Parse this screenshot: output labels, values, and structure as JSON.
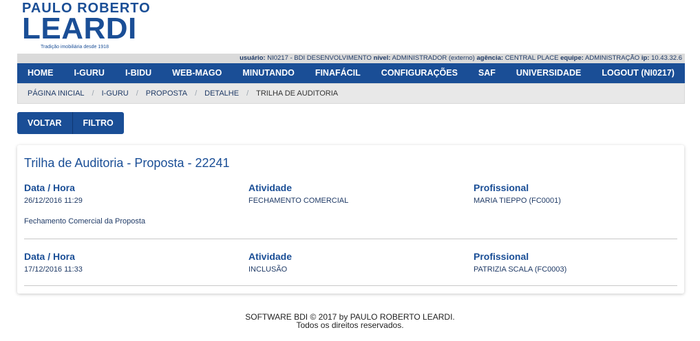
{
  "logo": {
    "line1": "PAULO ROBERTO",
    "line2": "LEARDI",
    "tagline": "Tradição imobiliária desde 1918"
  },
  "infobar": {
    "usuario_label": "usuário:",
    "usuario_value": "NI0217 - BDI DESENVOLVIMENTO",
    "nivel_label": "nível:",
    "nivel_value": "ADMINISTRADOR (externo)",
    "agencia_label": "agência:",
    "agencia_value": "CENTRAL PLACE",
    "equipe_label": "equipe:",
    "equipe_value": "ADMINISTRAÇÃO",
    "ip_label": "ip:",
    "ip_value": "10.43.32.6"
  },
  "nav": {
    "items": [
      "HOME",
      "I-GURU",
      "I-BIDU",
      "WEB-MAGO",
      "MINUTANDO",
      "FINAFÁCIL",
      "CONFIGURAÇÕES",
      "SAF",
      "UNIVERSIDADE",
      "LOGOUT (NI0217)"
    ]
  },
  "breadcrumb": {
    "items": [
      "PÁGINA INICIAL",
      "I-GURU",
      "PROPOSTA",
      "DETALHE",
      "TRILHA DE AUDITORIA"
    ],
    "separator": "/"
  },
  "toolbar": {
    "voltar_label": "VOLTAR",
    "filtro_label": "FILTRO"
  },
  "card": {
    "title": "Trilha de Auditoria - Proposta - 22241",
    "labels": {
      "datetime": "Data / Hora",
      "activity": "Atividade",
      "professional": "Profissional"
    },
    "entries": [
      {
        "datetime": "26/12/2016 11:29",
        "activity": "FECHAMENTO COMERCIAL",
        "professional": "MARIA TIEPPO (FC0001)",
        "description": "Fechamento Comercial da Proposta"
      },
      {
        "datetime": "17/12/2016 11:33",
        "activity": "INCLUSÃO",
        "professional": "PATRIZIA SCALA (FC0003)",
        "description": ""
      }
    ]
  },
  "footer": {
    "line1": "SOFTWARE BDI © 2017 by PAULO ROBERTO LEARDI.",
    "line2": "Todos os direitos reservados."
  },
  "colors": {
    "brand_blue": "#1a4e96",
    "infobar_bg": "#dadada",
    "breadcrumb_bg": "#e8e8e8"
  }
}
